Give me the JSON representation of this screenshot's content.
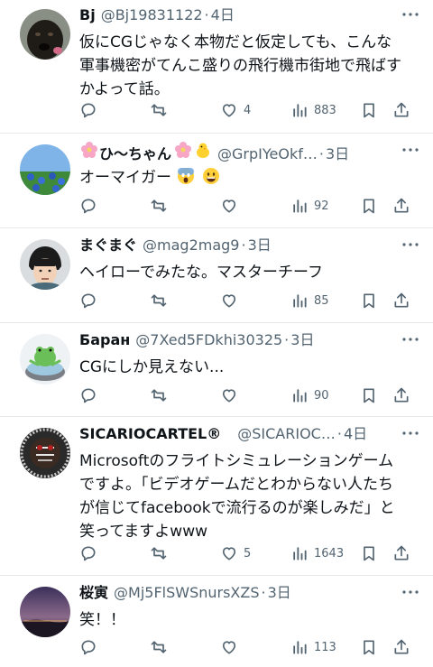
{
  "tweets": [
    {
      "name": "Bj",
      "handle": "@Bj19831122",
      "time": "4日",
      "text_lines": [
        "仮にCGじゃなく本物だと仮定しても、こんな",
        "軍事機密がてんこ盛りの飛行機市街地で飛ばす",
        "かよって話。"
      ],
      "likes": "4",
      "views": "883"
    },
    {
      "name": "ひ〜ちゃん",
      "handle": "@GrpIYeOkf…",
      "time": "3日",
      "text_lines": [
        "オーマイガー"
      ],
      "likes": "",
      "views": "92"
    },
    {
      "name": "まぐまぐ",
      "handle": "@mag2mag9",
      "time": "3日",
      "text_lines": [
        "ヘイローでみたな。マスターチーフ"
      ],
      "likes": "",
      "views": "85"
    },
    {
      "name": "Баран",
      "handle": "@7Xed5FDkhi30325",
      "time": "3日",
      "text_lines": [
        "CGにしか見えない..."
      ],
      "likes": "",
      "views": "90"
    },
    {
      "name": "SICARIOCARTEL®",
      "handle": "@SICARIOC…",
      "time": "4日",
      "text_lines": [
        "Microsoftのフライトシミュレーションゲーム",
        "ですよ。「ビデオゲームだとわからない人たち",
        "が信じてfacebookで流行るのが楽しみだ」と",
        "笑ってますよwww"
      ],
      "likes": "5",
      "views": "1643"
    },
    {
      "name": "桜寅",
      "handle": "@Mj5FlSWSnursXZS",
      "time": "3日",
      "text_lines": [
        "笑！！"
      ],
      "likes": "",
      "views": "113"
    }
  ],
  "sep": "·",
  "icons": {
    "more": "more-dots-icon",
    "reply": "reply-icon",
    "retweet": "retweet-icon",
    "like": "heart-icon",
    "views": "views-chart-icon",
    "bookmark": "bookmark-icon",
    "share": "share-icon"
  },
  "colors": {
    "text": "#0f1419",
    "muted": "#536471",
    "divider": "#e6e9eb"
  }
}
